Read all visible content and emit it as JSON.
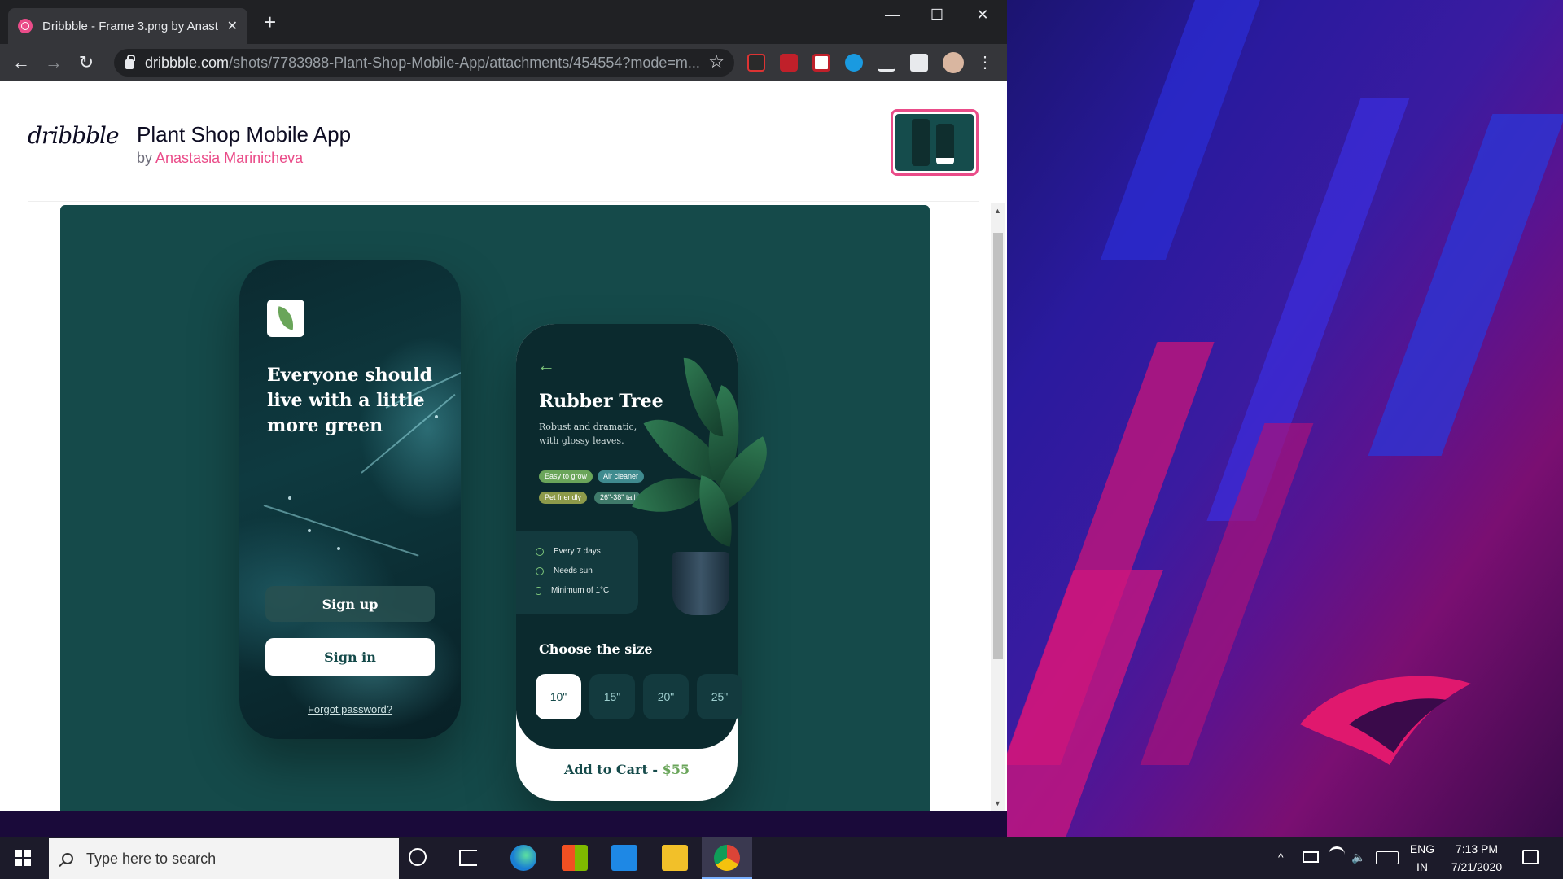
{
  "browser": {
    "tab_title": "Dribbble - Frame 3.png by Anast",
    "tab_close": "✕",
    "new_tab": "+",
    "minimize": "—",
    "maximize": "☐",
    "close": "✕",
    "back": "←",
    "forward": "→",
    "reload": "↻",
    "url_host": "dribbble.com",
    "url_path": "/shots/7783988-Plant-Shop-Mobile-App/attachments/454554?mode=m...",
    "bookmark_star": "☆",
    "menu": "⋮"
  },
  "page": {
    "logo": "dribbble",
    "shot_title": "Plant Shop Mobile App",
    "by_label": "by ",
    "author": "Anastasia Marinicheva"
  },
  "app1": {
    "tagline": "Everyone should live with a little more green",
    "signup_label": "Sign up",
    "signin_label": "Sign in",
    "forgot_label": "Forgot password?"
  },
  "app2": {
    "back_arrow": "←",
    "plant_name": "Rubber Tree",
    "plant_desc": "Robust and dramatic, with  glossy leaves.",
    "chips": [
      {
        "label": "Easy to grow",
        "color": "#6aa55a"
      },
      {
        "label": "Air cleaner",
        "color": "#3f8b8f"
      },
      {
        "label": "Pet friendly",
        "color": "#8d9a4a"
      },
      {
        "label": "26\"-38\" tall",
        "color": "#3f7a6a"
      }
    ],
    "care": [
      "Every 7 days",
      "Needs sun",
      "Minimum of 1°C"
    ],
    "size_title": "Choose the size",
    "sizes": [
      "10\"",
      "15\"",
      "20\"",
      "25\""
    ],
    "selected_size": "10\"",
    "add_cart_label": "Add to Cart - ",
    "price": "$55"
  },
  "taskbar": {
    "search_placeholder": "Type here to search",
    "lang_top": "ENG",
    "lang_bottom": "IN",
    "time": "7:13 PM",
    "date": "7/21/2020"
  },
  "colors": {
    "accent": "#ea4c89",
    "shot_bg": "#154a4a"
  }
}
